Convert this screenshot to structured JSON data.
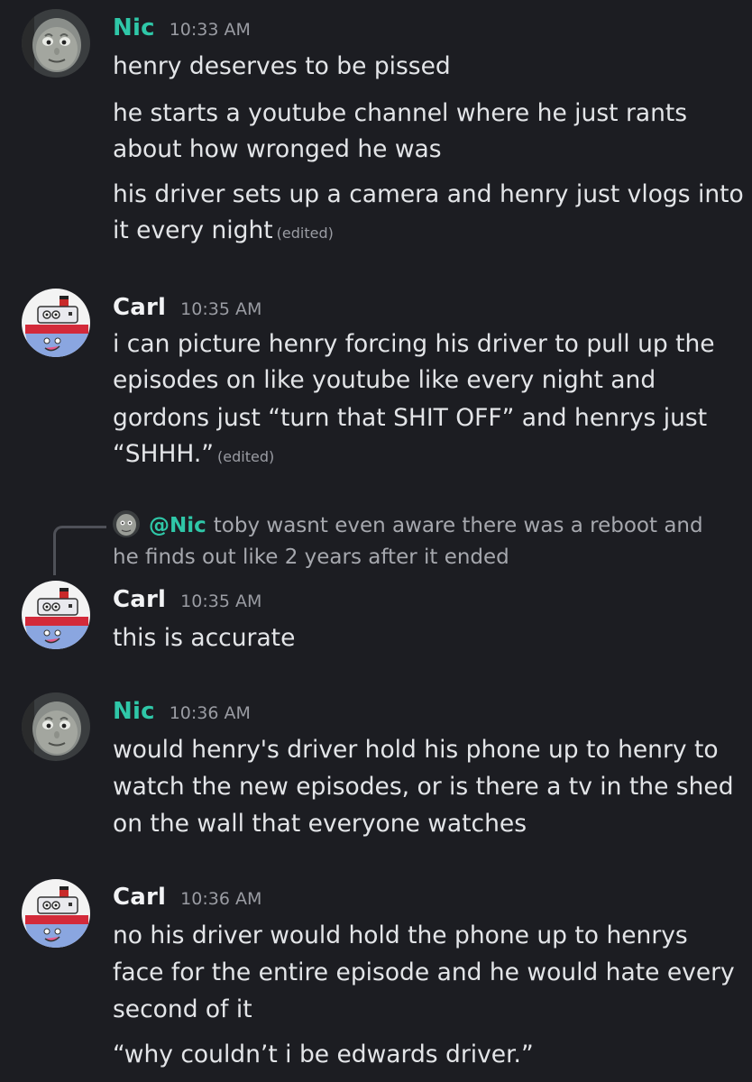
{
  "users": {
    "nic": {
      "name": "Nic",
      "color": "#2fc7a8",
      "avatar_icon": "engine-face-avatar-icon"
    },
    "carl": {
      "name": "Carl",
      "color": "#f2f3f5",
      "avatar_icon": "tugboat-avatar-icon"
    }
  },
  "messages": [
    {
      "author": "Nic",
      "time": "10:33 AM",
      "lines": [
        "henry deserves to be pissed",
        "he starts a youtube channel where he just rants",
        "about how wronged he was",
        "his driver sets up a camera and henry just vlogs into",
        "it every night"
      ],
      "edited": "(edited)"
    },
    {
      "author": "Carl",
      "time": "10:35 AM",
      "lines": [
        "i can picture henry forcing his driver to pull up the",
        "episodes on like youtube like every night and",
        "gordons just “turn that SHIT OFF” and henrys just",
        "“SHHH.”"
      ],
      "edited": "(edited)"
    },
    {
      "author": "Carl",
      "time": "10:35 AM",
      "reply": {
        "mention": "@Nic",
        "line1": "toby wasnt even aware there was a reboot and",
        "line2": "he finds out like 2 years after it ended"
      },
      "lines": [
        "this is accurate"
      ]
    },
    {
      "author": "Nic",
      "time": "10:36 AM",
      "lines": [
        "would henry's driver hold his phone up to henry to",
        "watch the new episodes, or is there a tv in the shed",
        "on the wall that everyone watches"
      ]
    },
    {
      "author": "Carl",
      "time": "10:36 AM",
      "lines": [
        "no his driver would hold the phone up to henrys",
        "face for the entire episode and he would hate every",
        "second of it",
        "“why couldn’t i be edwards driver.”"
      ]
    }
  ]
}
